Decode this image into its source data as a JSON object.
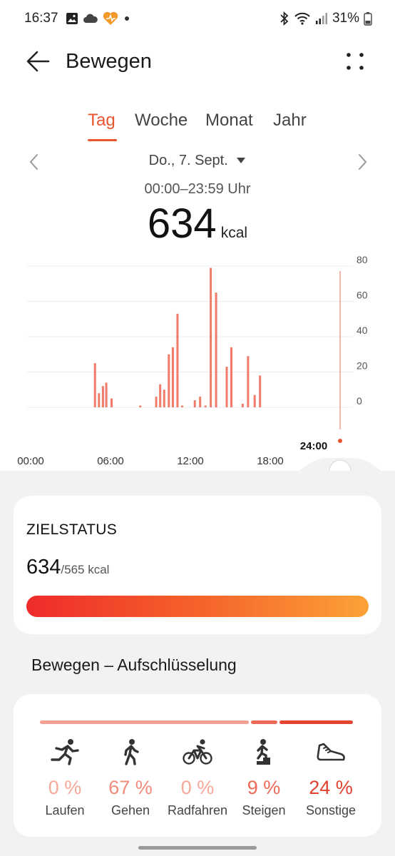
{
  "status_bar": {
    "time": "16:37",
    "battery": "31%",
    "icons_left": [
      "image-icon",
      "cloud-icon",
      "heart-icon",
      "dot-icon"
    ],
    "icons_right": [
      "bluetooth-icon",
      "wifi-icon",
      "signal-icon",
      "battery-icon"
    ]
  },
  "header": {
    "title": "Bewegen"
  },
  "tabs": [
    {
      "label": "Tag",
      "active": true
    },
    {
      "label": "Woche",
      "active": false
    },
    {
      "label": "Monat",
      "active": false
    },
    {
      "label": "Jahr",
      "active": false
    }
  ],
  "date_nav": {
    "date": "Do., 7. Sept.",
    "time_range": "00:00–23:59 Uhr"
  },
  "summary": {
    "value": "634",
    "unit": "kcal"
  },
  "chart_data": {
    "type": "bar",
    "x": [
      5.1,
      5.4,
      5.7,
      5.95,
      6.35,
      8.5,
      9.7,
      10.0,
      10.3,
      10.65,
      10.95,
      11.3,
      11.65,
      12.6,
      13.0,
      13.4,
      13.8,
      14.2,
      14.55,
      15.0,
      15.35,
      15.8,
      16.2,
      16.6,
      17.1,
      17.5,
      17.9,
      18.35,
      18.75,
      19.2,
      19.6,
      20.15,
      20.55,
      20.9
    ],
    "values": [
      25,
      8,
      12,
      14,
      5,
      1,
      6,
      13,
      10,
      30,
      34,
      53,
      1,
      4,
      6,
      1,
      79,
      65,
      0,
      23,
      34,
      0,
      2,
      29,
      7,
      18,
      0,
      0,
      0,
      0,
      0,
      0,
      0,
      0
    ],
    "xlim": [
      0,
      24
    ],
    "ylim": [
      0,
      80
    ],
    "x_ticks": [
      "00:00",
      "06:00",
      "12:00",
      "18:00",
      "24:00"
    ],
    "y_ticks": [
      "80",
      "60",
      "40",
      "20",
      "0"
    ],
    "bar_color": "#f07b68",
    "grid": true
  },
  "goal": {
    "title": "ZIELSTATUS",
    "value": "634",
    "target": "/565 kcal",
    "progress": 1.0
  },
  "breakdown": {
    "title": "Bewegen – Aufschlüsselung",
    "segments": [
      {
        "fraction": 0.67,
        "color": "#f4a194"
      },
      {
        "fraction": 0.09,
        "color": "#ec6a55"
      },
      {
        "fraction": 0.24,
        "color": "#e54432"
      }
    ],
    "categories": [
      {
        "label": "Laufen",
        "pct": "0 %",
        "icon": "running-icon",
        "color": "#f5a898"
      },
      {
        "label": "Gehen",
        "pct": "67 %",
        "icon": "walking-icon",
        "color": "#f28b7a"
      },
      {
        "label": "Radfahren",
        "pct": "0 %",
        "icon": "cycling-icon",
        "color": "#f5a898"
      },
      {
        "label": "Steigen",
        "pct": "9 %",
        "icon": "climbing-icon",
        "color": "#ec6a55"
      },
      {
        "label": "Sonstige",
        "pct": "24 %",
        "icon": "shoe-icon",
        "color": "#e0412f"
      }
    ]
  }
}
